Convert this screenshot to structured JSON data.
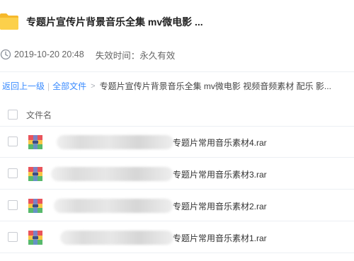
{
  "header": {
    "title": "专题片宣传片背景音乐全集 mv微电影 ...",
    "icon": "folder-icon"
  },
  "meta": {
    "date": "2019-10-20 20:48",
    "expire": "失效时间：永久有效",
    "icon": "clock-icon"
  },
  "breadcrumb": {
    "back": "返回上一级",
    "separator": "|",
    "all_files": "全部文件",
    "arrow": ">",
    "current": "专题片宣传片背景音乐全集 mv微电影 视频音频素材 配乐 影..."
  },
  "list": {
    "column_name": "文件名",
    "files": [
      {
        "name": "专题片常用音乐素材4.rar",
        "icon": "rar-archive-icon"
      },
      {
        "name": "专题片常用音乐素材3.rar",
        "icon": "rar-archive-icon"
      },
      {
        "name": "专题片常用音乐素材2.rar",
        "icon": "rar-archive-icon"
      },
      {
        "name": "专题片常用音乐素材1.rar",
        "icon": "rar-archive-icon"
      }
    ]
  },
  "colors": {
    "link": "#3b8cff",
    "folder": "#f9c23c",
    "divider": "#eceff3"
  }
}
